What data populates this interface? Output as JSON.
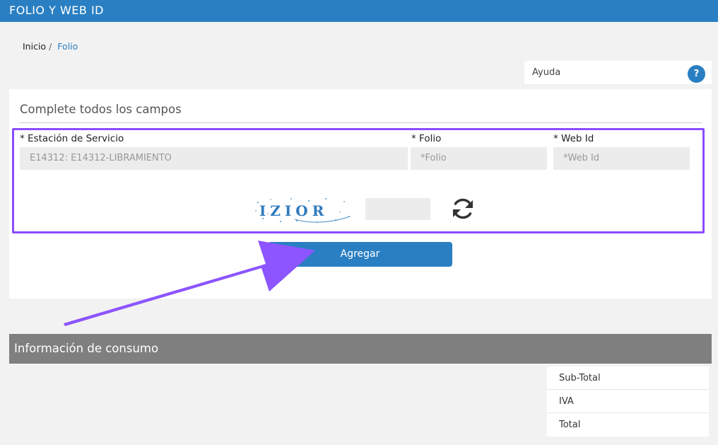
{
  "header": {
    "title": "FOLIO Y WEB ID"
  },
  "breadcrumb": {
    "home": "Inicio",
    "separator": "/",
    "current": "Folio"
  },
  "help": {
    "label": "Ayuda",
    "icon": "?"
  },
  "form": {
    "heading": "Complete todos los campos",
    "station": {
      "label": "* Estación de Servicio",
      "value": "E14312: E14312-LIBRAMIENTO"
    },
    "folio": {
      "label": "* Folio",
      "placeholder": "*Folio"
    },
    "webid": {
      "label": "* Web Id",
      "placeholder": "*Web Id"
    },
    "captcha_text": "IZIOR",
    "submit_label": "Agregar"
  },
  "consumo": {
    "title": "Información de consumo",
    "rows": [
      "Sub-Total",
      "IVA",
      "Total"
    ]
  },
  "colors": {
    "primary": "#2a7fc2",
    "highlight": "#8a4dff",
    "arrow": "#8c55ff",
    "section_bar": "#7f7f7f"
  },
  "icons": {
    "help": "question-circle-icon",
    "refresh": "refresh-icon"
  }
}
